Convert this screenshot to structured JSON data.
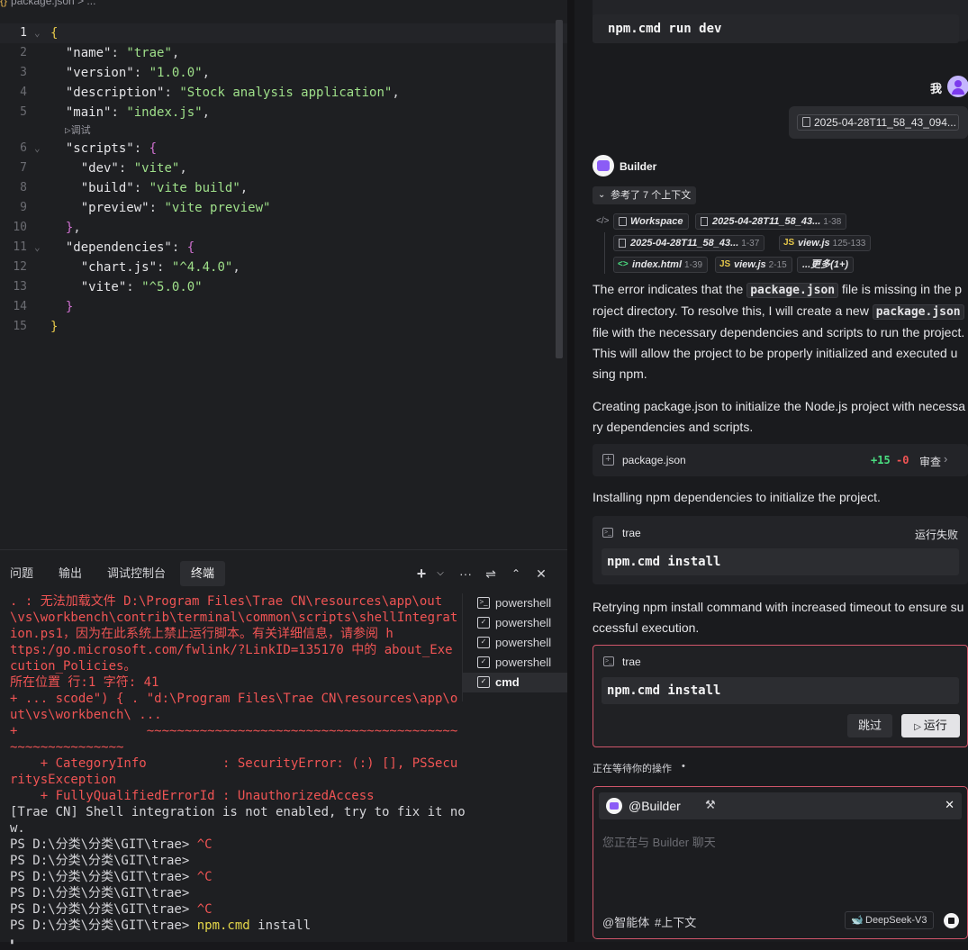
{
  "editor": {
    "breadcrumb": "package.json  >  ...",
    "codelens": "▷调试",
    "lines": [
      {
        "n": "1",
        "t": "{"
      },
      {
        "n": "2",
        "t": "  \"name\": \"trae\","
      },
      {
        "n": "3",
        "t": "  \"version\": \"1.0.0\","
      },
      {
        "n": "4",
        "t": "  \"description\": \"Stock analysis application\","
      },
      {
        "n": "5",
        "t": "  \"main\": \"index.js\","
      },
      {
        "n": "6",
        "t": "  \"scripts\": {"
      },
      {
        "n": "7",
        "t": "    \"dev\": \"vite\","
      },
      {
        "n": "8",
        "t": "    \"build\": \"vite build\","
      },
      {
        "n": "9",
        "t": "    \"preview\": \"vite preview\""
      },
      {
        "n": "10",
        "t": "  },"
      },
      {
        "n": "11",
        "t": "  \"dependencies\": {"
      },
      {
        "n": "12",
        "t": "    \"chart.js\": \"^4.4.0\","
      },
      {
        "n": "13",
        "t": "    \"vite\": \"^5.0.0\""
      },
      {
        "n": "14",
        "t": "  }"
      },
      {
        "n": "15",
        "t": "}"
      }
    ]
  },
  "panel": {
    "tabs": [
      "问题",
      "输出",
      "调试控制台",
      "终端"
    ],
    "terminal_lines": [
      {
        "c": "err",
        "t": ". : 无法加载文件 D:\\Program Files\\Trae CN\\resources\\app\\out"
      },
      {
        "c": "err",
        "t": "\\vs\\workbench\\contrib\\terminal\\common\\scripts\\shellIntegrat"
      },
      {
        "c": "err",
        "t": "ion.ps1，因为在此系统上禁止运行脚本。有关详细信息，请参阅 h"
      },
      {
        "c": "err",
        "t": "ttps:/go.microsoft.com/fwlink/?LinkID=135170 中的 about_Exe"
      },
      {
        "c": "err",
        "t": "cution_Policies。"
      },
      {
        "c": "err",
        "t": "所在位置 行:1 字符: 41"
      },
      {
        "c": "err",
        "t": "+ ... scode\") { . \"d:\\Program Files\\Trae CN\\resources\\app\\o"
      },
      {
        "c": "err",
        "t": "ut\\vs\\workbench\\ ..."
      },
      {
        "c": "err",
        "t": "+                 ~~~~~~~~~~~~~~~~~~~~~~~~~~~~~~~~~~~~~~~~~"
      },
      {
        "c": "err",
        "t": "~~~~~~~~~~~~~~~"
      },
      {
        "c": "err",
        "t": "    + CategoryInfo          : SecurityError: (:) [], PSSecu"
      },
      {
        "c": "err",
        "t": "ritysException"
      },
      {
        "c": "err",
        "t": "    + FullyQualifiedErrorId : UnauthorizedAccess"
      },
      {
        "c": "norm",
        "t": "[Trae CN] Shell integration is not enabled, try to fix it no"
      },
      {
        "c": "norm",
        "t": "w."
      }
    ],
    "prompts": [
      {
        "p": "PS D:\\分类\\分类\\GIT\\trae> ",
        "x": "^C",
        "cls": "t-r"
      },
      {
        "p": "PS D:\\分类\\分类\\GIT\\trae>",
        "x": "",
        "cls": "t-r"
      },
      {
        "p": "PS D:\\分类\\分类\\GIT\\trae> ",
        "x": "^C",
        "cls": "t-r"
      },
      {
        "p": "PS D:\\分类\\分类\\GIT\\trae>",
        "x": "",
        "cls": "t-r"
      },
      {
        "p": "PS D:\\分类\\分类\\GIT\\trae> ",
        "x": "^C",
        "cls": "t-r"
      },
      {
        "p": "PS D:\\分类\\分类\\GIT\\trae> ",
        "x": "npm.cmd",
        "cls": "t-y",
        "rest": " install"
      }
    ],
    "term_list": [
      "powershell",
      "powershell",
      "powershell",
      "powershell",
      "cmd"
    ]
  },
  "chat": {
    "top_code": "npm.cmd run dev",
    "user_label": "我",
    "user_file": "2025-04-28T11_58_43_094...",
    "builder_name": "Builder",
    "context_toggle": "参考了 7 个上下文",
    "ctx": {
      "workspace": "Workspace",
      "f1": "2025-04-28T11_58_43...",
      "f1r": "1-38",
      "f2": "2025-04-28T11_58_43...",
      "f2r": "1-37",
      "f3": "view.js",
      "f3r": "125-133",
      "f4": "index.html",
      "f4r": "1-39",
      "f5": "view.js",
      "f5r": "2-15",
      "more": "...更多(1+)"
    },
    "msg1": {
      "a": "The error indicates that the ",
      "code1": "package.json",
      "b": " file is missing in the p",
      "c": "roject directory. To resolve this, I will create a new ",
      "code2": "package.json",
      "d": "file with the necessary dependencies and scripts to run the project.",
      "e": "This will allow the project to be properly initialized and executed u",
      "f": "sing npm."
    },
    "msg2": [
      "Creating package.json to initialize the Node.js project with necessa",
      "ry dependencies and scripts."
    ],
    "file_card": {
      "name": "package.json",
      "added": "+15",
      "removed": "-0",
      "review": "审查"
    },
    "msg3": "Installing npm dependencies to initialize the project.",
    "card1": {
      "label": "trae",
      "status": "运行失败",
      "cmd": "npm.cmd install"
    },
    "msg4": [
      "Retrying npm install command with increased timeout to ensure su",
      "ccessful execution."
    ],
    "card2": {
      "label": "trae",
      "cmd": "npm.cmd install",
      "skip": "跳过",
      "run": "运行"
    },
    "waiting": "正在等待你的操作",
    "input": {
      "mention": "@Builder",
      "placeholder": "您正在与 Builder 聊天",
      "agent": "智能体",
      "context": "上下文",
      "model": "DeepSeek-V3"
    }
  },
  "colors": {
    "accent": "#a78bfa",
    "error": "#f05454",
    "warning": "#e6d84a",
    "added": "#4ade80"
  }
}
